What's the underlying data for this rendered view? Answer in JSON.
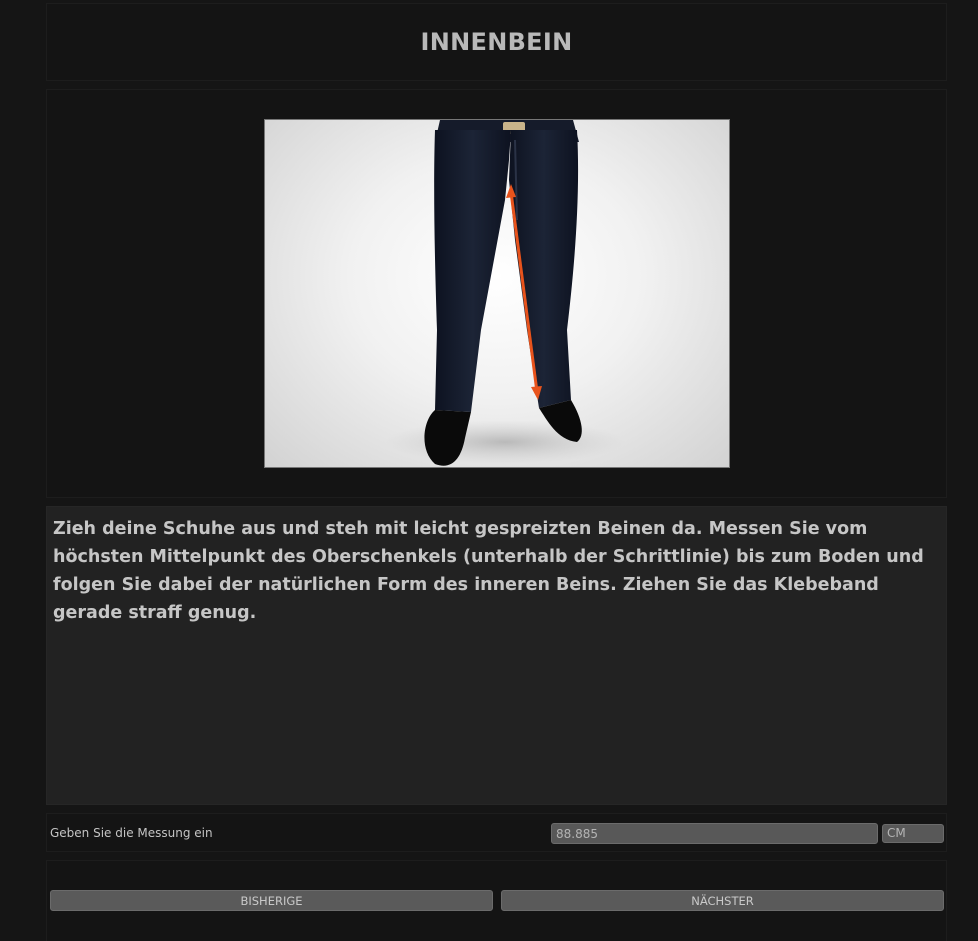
{
  "header": {
    "title": "INNENBEIN"
  },
  "main": {
    "description": "Zieh deine Schuhe aus und steh mit leicht gespreizten Beinen da. Messen Sie vom höchsten Mittelpunkt des Oberschenkels (unterhalb der Schrittlinie) bis zum Boden und folgen Sie dabei der natürlichen Form des inneren Beins. Ziehen Sie das Klebeband gerade straff genug."
  },
  "measurement": {
    "label": "Geben Sie die Messung ein",
    "value": "88.885",
    "unit": "CM"
  },
  "navigation": {
    "previous_label": "BISHERIGE",
    "next_label": "NÄCHSTER"
  },
  "colors": {
    "background": "#151515",
    "panel": "#141414",
    "description_bg": "#222222",
    "button": "#5a5a5a",
    "arrow": "#e8531c"
  }
}
